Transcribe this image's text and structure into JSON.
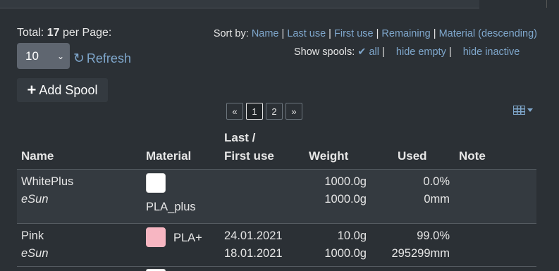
{
  "header": {
    "total_label": "Total:",
    "total_count": "17",
    "per_page_label": "per Page:",
    "per_page_value": "10",
    "refresh_label": "Refresh"
  },
  "sort": {
    "label": "Sort by:",
    "options": [
      "Name",
      "Last use",
      "First use",
      "Remaining",
      "Material (descending)"
    ]
  },
  "filter": {
    "label": "Show spools:",
    "options": [
      "all",
      "hide empty",
      "hide inactive"
    ],
    "active": "all"
  },
  "add_button_label": "Add Spool",
  "pagination": {
    "prev": "«",
    "pages": [
      "1",
      "2"
    ],
    "current": "1",
    "next": "»"
  },
  "table": {
    "columns": {
      "name": "Name",
      "material": "Material",
      "last_first_use_line1": "Last /",
      "last_first_use_line2": "First use",
      "weight": "Weight",
      "used": "Used",
      "note": "Note"
    },
    "rows": [
      {
        "name": "WhitePlus",
        "vendor": "eSun",
        "color": "#ffffff",
        "material": "PLA_plus",
        "last_use": "",
        "first_use": "",
        "weight_remaining": "1000.0g",
        "weight_total": "1000.0g",
        "used_percent": "0.0%",
        "used_length": "0mm",
        "note": ""
      },
      {
        "name": "Pink",
        "vendor": "eSun",
        "color": "#f7b6c2",
        "material": "PLA+",
        "last_use": "24.01.2021",
        "first_use": "18.01.2021",
        "weight_remaining": "10.0g",
        "weight_total": "1000.0g",
        "used_percent": "99.0%",
        "used_length": "295299mm",
        "note": ""
      }
    ]
  },
  "colors": {
    "background": "#2b3035",
    "link": "#7fa7cc",
    "select_bg": "#5f6670"
  }
}
